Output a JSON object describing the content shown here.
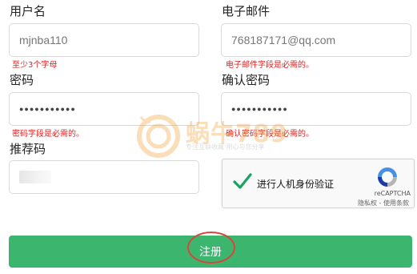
{
  "username": {
    "label": "用户名",
    "value": "mjnba110",
    "error": "至少3个字母"
  },
  "email": {
    "label": "电子邮件",
    "value": "768187171@qq.com",
    "error": "电子邮件字段是必需的。"
  },
  "password": {
    "label": "密码",
    "value": "●●●●●●●●●●●",
    "error": "密码字段是必需的。"
  },
  "confirm_password": {
    "label": "确认密码",
    "value": "●●●●●●●●●●●",
    "error": "确认密码字段是必需的。"
  },
  "referrer": {
    "label": "推荐码"
  },
  "recaptcha": {
    "label": "进行人机身份验证",
    "brand": "reCAPTCHA",
    "terms": "隐私权 - 使用条款",
    "check_color": "#1aa260"
  },
  "watermark": {
    "title": "蜗牛789",
    "subtitle": "专注互联收藏   用心与您分享"
  },
  "submit": {
    "label": "注册",
    "color": "#3cb56f"
  }
}
